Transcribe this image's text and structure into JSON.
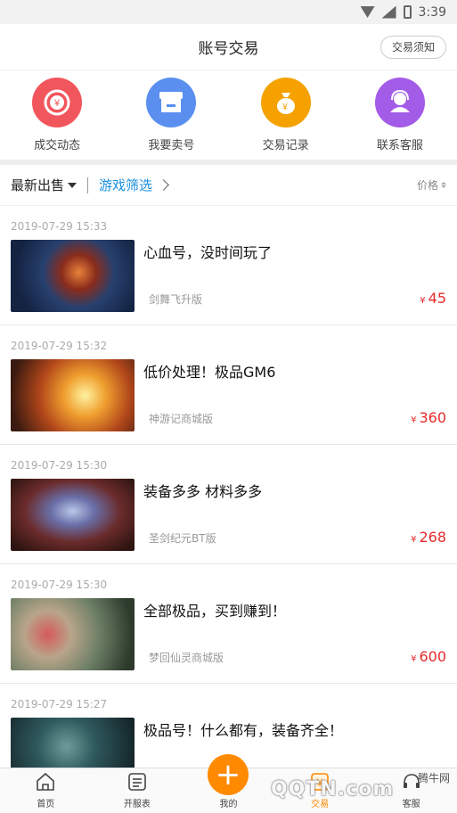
{
  "status": {
    "time": "3:39"
  },
  "header": {
    "title": "账号交易",
    "notice_button": "交易须知"
  },
  "shortcuts": [
    {
      "label": "成交动态",
      "icon": "deal-feed-icon",
      "color": "#f2565d"
    },
    {
      "label": "我要卖号",
      "icon": "store-icon",
      "color": "#5a8ff0"
    },
    {
      "label": "交易记录",
      "icon": "money-bag-icon",
      "color": "#f5a100"
    },
    {
      "label": "联系客服",
      "icon": "customer-service-icon",
      "color": "#a35ce8"
    }
  ],
  "filter": {
    "latest": "最新出售",
    "game_filter": "游戏筛选",
    "price": "价格"
  },
  "listings": [
    {
      "time": "2019-07-29 15:33",
      "title": "心血号，没时间玩了",
      "game": "剑舞飞升版",
      "currency": "¥",
      "price": "45"
    },
    {
      "time": "2019-07-29 15:32",
      "title": "低价处理！极品GM6",
      "game": "神游记商城版",
      "currency": "¥",
      "price": "360"
    },
    {
      "time": "2019-07-29 15:30",
      "title": "装备多多   材料多多",
      "game": "圣剑纪元BT版",
      "currency": "¥",
      "price": "268"
    },
    {
      "time": "2019-07-29 15:30",
      "title": "全部极品，买到赚到！",
      "game": "梦回仙灵商城版",
      "currency": "¥",
      "price": "600"
    },
    {
      "time": "2019-07-29 15:27",
      "title": "极品号！什么都有，装备齐全！",
      "game": "",
      "currency": "",
      "price": ""
    }
  ],
  "tabbar": {
    "home": "首页",
    "schedule": "开服表",
    "mine": "我的",
    "trade": "交易",
    "service": "客服",
    "fab": "+"
  },
  "watermark": {
    "logo": "QQTN.com",
    "cn": "腾牛网"
  },
  "colors": {
    "accent": "#ff8a00",
    "link": "#1a8fe0",
    "price": "#e52b2b"
  }
}
